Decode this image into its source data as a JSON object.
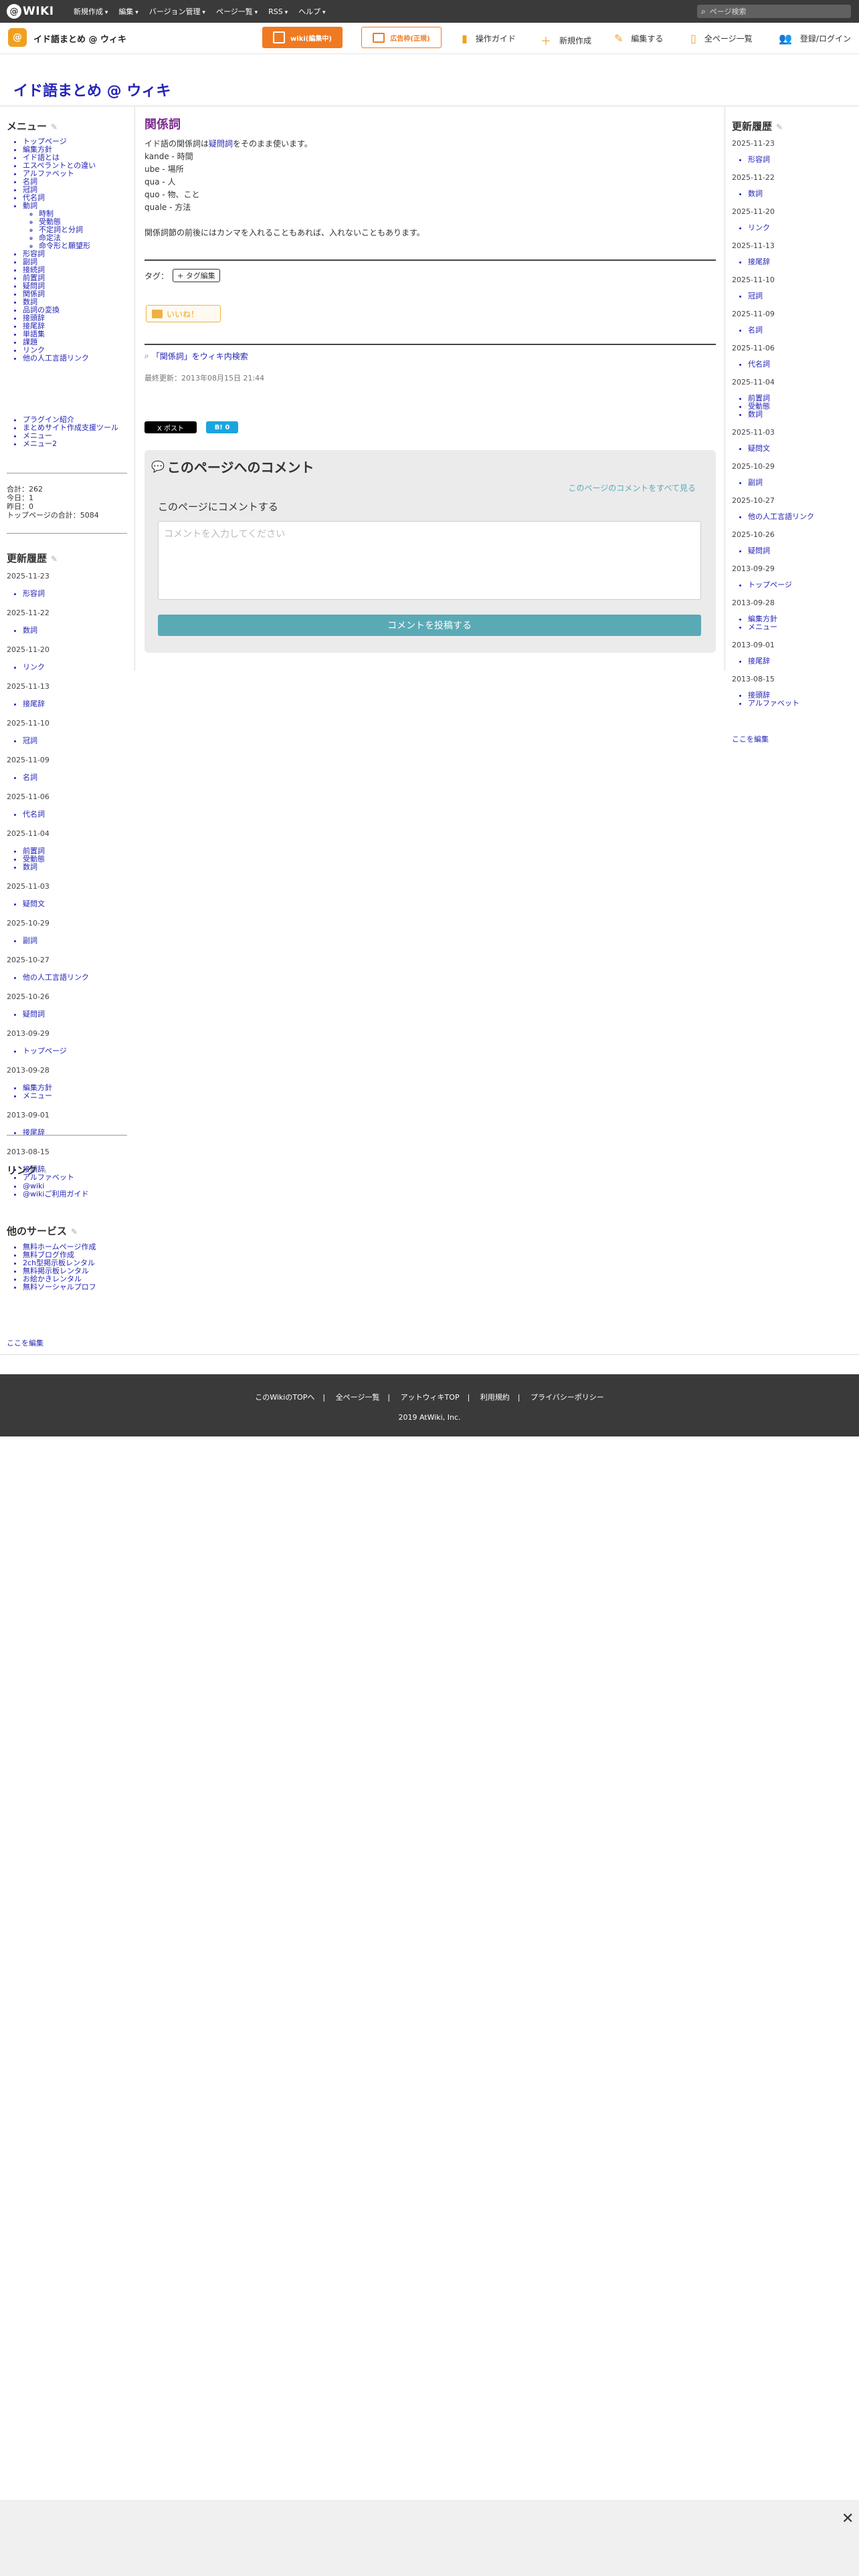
{
  "topbar": {
    "logo": "WIKI",
    "menu": [
      "新規作成",
      "編集",
      "バージョン管理",
      "ページ一覧",
      "RSS",
      "ヘルプ"
    ],
    "search_placeholder": "ページ検索"
  },
  "subbar": {
    "site_name": "イド語まとめ @ ウィキ",
    "edit_button": "wiki(編集中)",
    "ad_button": "広告枠(正規)",
    "tools": [
      "操作ガイド",
      "新規作成",
      "編集する",
      "全ページ一覧",
      "登録/ログイン"
    ]
  },
  "page_title": "イド語まとめ @ ウィキ",
  "left_menu": {
    "title": "メニュー",
    "items": [
      "トップページ",
      "編集方針",
      "イド語とは",
      "エスペラントとの違い",
      "アルファベット",
      "名詞",
      "冠詞",
      "代名詞",
      "動詞"
    ],
    "verb_sub": [
      "時制",
      "受動態",
      "不定詞と分詞",
      "命定法",
      "命令形と願望形"
    ],
    "items2": [
      "形容詞",
      "副詞",
      "接続詞",
      "前置詞",
      "疑問詞",
      "関係詞",
      "数詞",
      "品詞の変換",
      "接頭辞",
      "接尾辞",
      "単語集",
      "課題",
      "リンク",
      "他の人工言語リンク"
    ],
    "items3": [
      "プラグイン紹介",
      "まとめサイト作成支援ツール",
      "メニュー",
      "メニュー2"
    ],
    "counter": [
      "合計：262",
      "今日：1",
      "昨日：0",
      "トップページの合計：5084"
    ]
  },
  "left_recent": {
    "title": "更新履歴",
    "groups": [
      {
        "date": "2025-11-23",
        "items": [
          "形容詞"
        ]
      },
      {
        "date": "2025-11-22",
        "items": [
          "数詞"
        ]
      },
      {
        "date": "2025-11-20",
        "items": [
          "リンク"
        ]
      },
      {
        "date": "2025-11-13",
        "items": [
          "接尾辞"
        ]
      },
      {
        "date": "2025-11-10",
        "items": [
          "冠詞"
        ]
      },
      {
        "date": "2025-11-09",
        "items": [
          "名詞"
        ]
      },
      {
        "date": "2025-11-06",
        "items": [
          "代名詞"
        ]
      },
      {
        "date": "2025-11-04",
        "items": [
          "前置詞",
          "受動態",
          "数詞"
        ]
      },
      {
        "date": "2025-11-03",
        "items": [
          "疑問文"
        ]
      },
      {
        "date": "2025-10-29",
        "items": [
          "副詞"
        ]
      },
      {
        "date": "2025-10-27",
        "items": [
          "他の人工言語リンク"
        ]
      },
      {
        "date": "2025-10-26",
        "items": [
          "疑問詞"
        ]
      },
      {
        "date": "2013-09-29",
        "items": [
          "トップページ"
        ]
      },
      {
        "date": "2013-09-28",
        "items": [
          "編集方針",
          "メニュー"
        ]
      },
      {
        "date": "2013-09-01",
        "items": [
          "接尾辞"
        ]
      },
      {
        "date": "2013-08-15",
        "items": [
          "接頭辞",
          "アルファベット"
        ]
      }
    ]
  },
  "links": {
    "title": "リンク",
    "items": [
      "@wiki",
      "@wikiご利用ガイド"
    ]
  },
  "services": {
    "title": "他のサービス",
    "items": [
      "無料ホームページ作成",
      "無料ブログ作成",
      "2ch型掲示板レンタル",
      "無料掲示板レンタル",
      "お絵かきレンタル",
      "無料ソーシャルプロフ"
    ]
  },
  "left_edit_here": "ここを編集",
  "main": {
    "heading": "関係詞",
    "intro_pre": "イド語の関係詞は",
    "intro_link": "疑問詞",
    "intro_post": "をそのまま使います。",
    "lines": [
      "kande - 時間",
      "ube - 場所",
      "qua - 人",
      "quo - 物、こと",
      "quale - 方法"
    ],
    "note": "関係詞節の前後にはカンマを入れることもあれば、入れないこともあります。",
    "tag_label": "タグ：",
    "tag_button": "+ タグ編集",
    "like": "いいね！",
    "search_text": "「関係詞」をウィキ内検索",
    "last_updated": "最終更新：2013年08月15日 21:44",
    "x_post": "X ポスト",
    "b_button": "B! 0"
  },
  "comments": {
    "title": "このページへのコメント",
    "view_all": "このページのコメントをすべて見る",
    "label": "このページにコメントする",
    "placeholder": "コメントを入力してください",
    "submit": "コメントを投稿する"
  },
  "right_recent": {
    "title": "更新履歴",
    "groups": [
      {
        "date": "2025-11-23",
        "items": [
          "形容詞"
        ]
      },
      {
        "date": "2025-11-22",
        "items": [
          "数詞"
        ]
      },
      {
        "date": "2025-11-20",
        "items": [
          "リンク"
        ]
      },
      {
        "date": "2025-11-13",
        "items": [
          "接尾辞"
        ]
      },
      {
        "date": "2025-11-10",
        "items": [
          "冠詞"
        ]
      },
      {
        "date": "2025-11-09",
        "items": [
          "名詞"
        ]
      },
      {
        "date": "2025-11-06",
        "items": [
          "代名詞"
        ]
      },
      {
        "date": "2025-11-04",
        "items": [
          "前置詞",
          "受動態",
          "数詞"
        ]
      },
      {
        "date": "2025-11-03",
        "items": [
          "疑問文"
        ]
      },
      {
        "date": "2025-10-29",
        "items": [
          "副詞"
        ]
      },
      {
        "date": "2025-10-27",
        "items": [
          "他の人工言語リンク"
        ]
      },
      {
        "date": "2025-10-26",
        "items": [
          "疑問詞"
        ]
      },
      {
        "date": "2013-09-29",
        "items": [
          "トップページ"
        ]
      },
      {
        "date": "2013-09-28",
        "items": [
          "編集方針",
          "メニュー"
        ]
      },
      {
        "date": "2013-09-01",
        "items": [
          "接尾辞"
        ]
      },
      {
        "date": "2013-08-15",
        "items": [
          "接頭辞",
          "アルファベット"
        ]
      }
    ],
    "edit_here": "ここを編集"
  },
  "footer": {
    "links": [
      "このWikiのTOPへ",
      "全ページ一覧",
      "アットウィキTOP",
      "利用規約",
      "プライバシーポリシー"
    ],
    "copyright": "2019 AtWiki, Inc."
  },
  "close_label": "✕"
}
